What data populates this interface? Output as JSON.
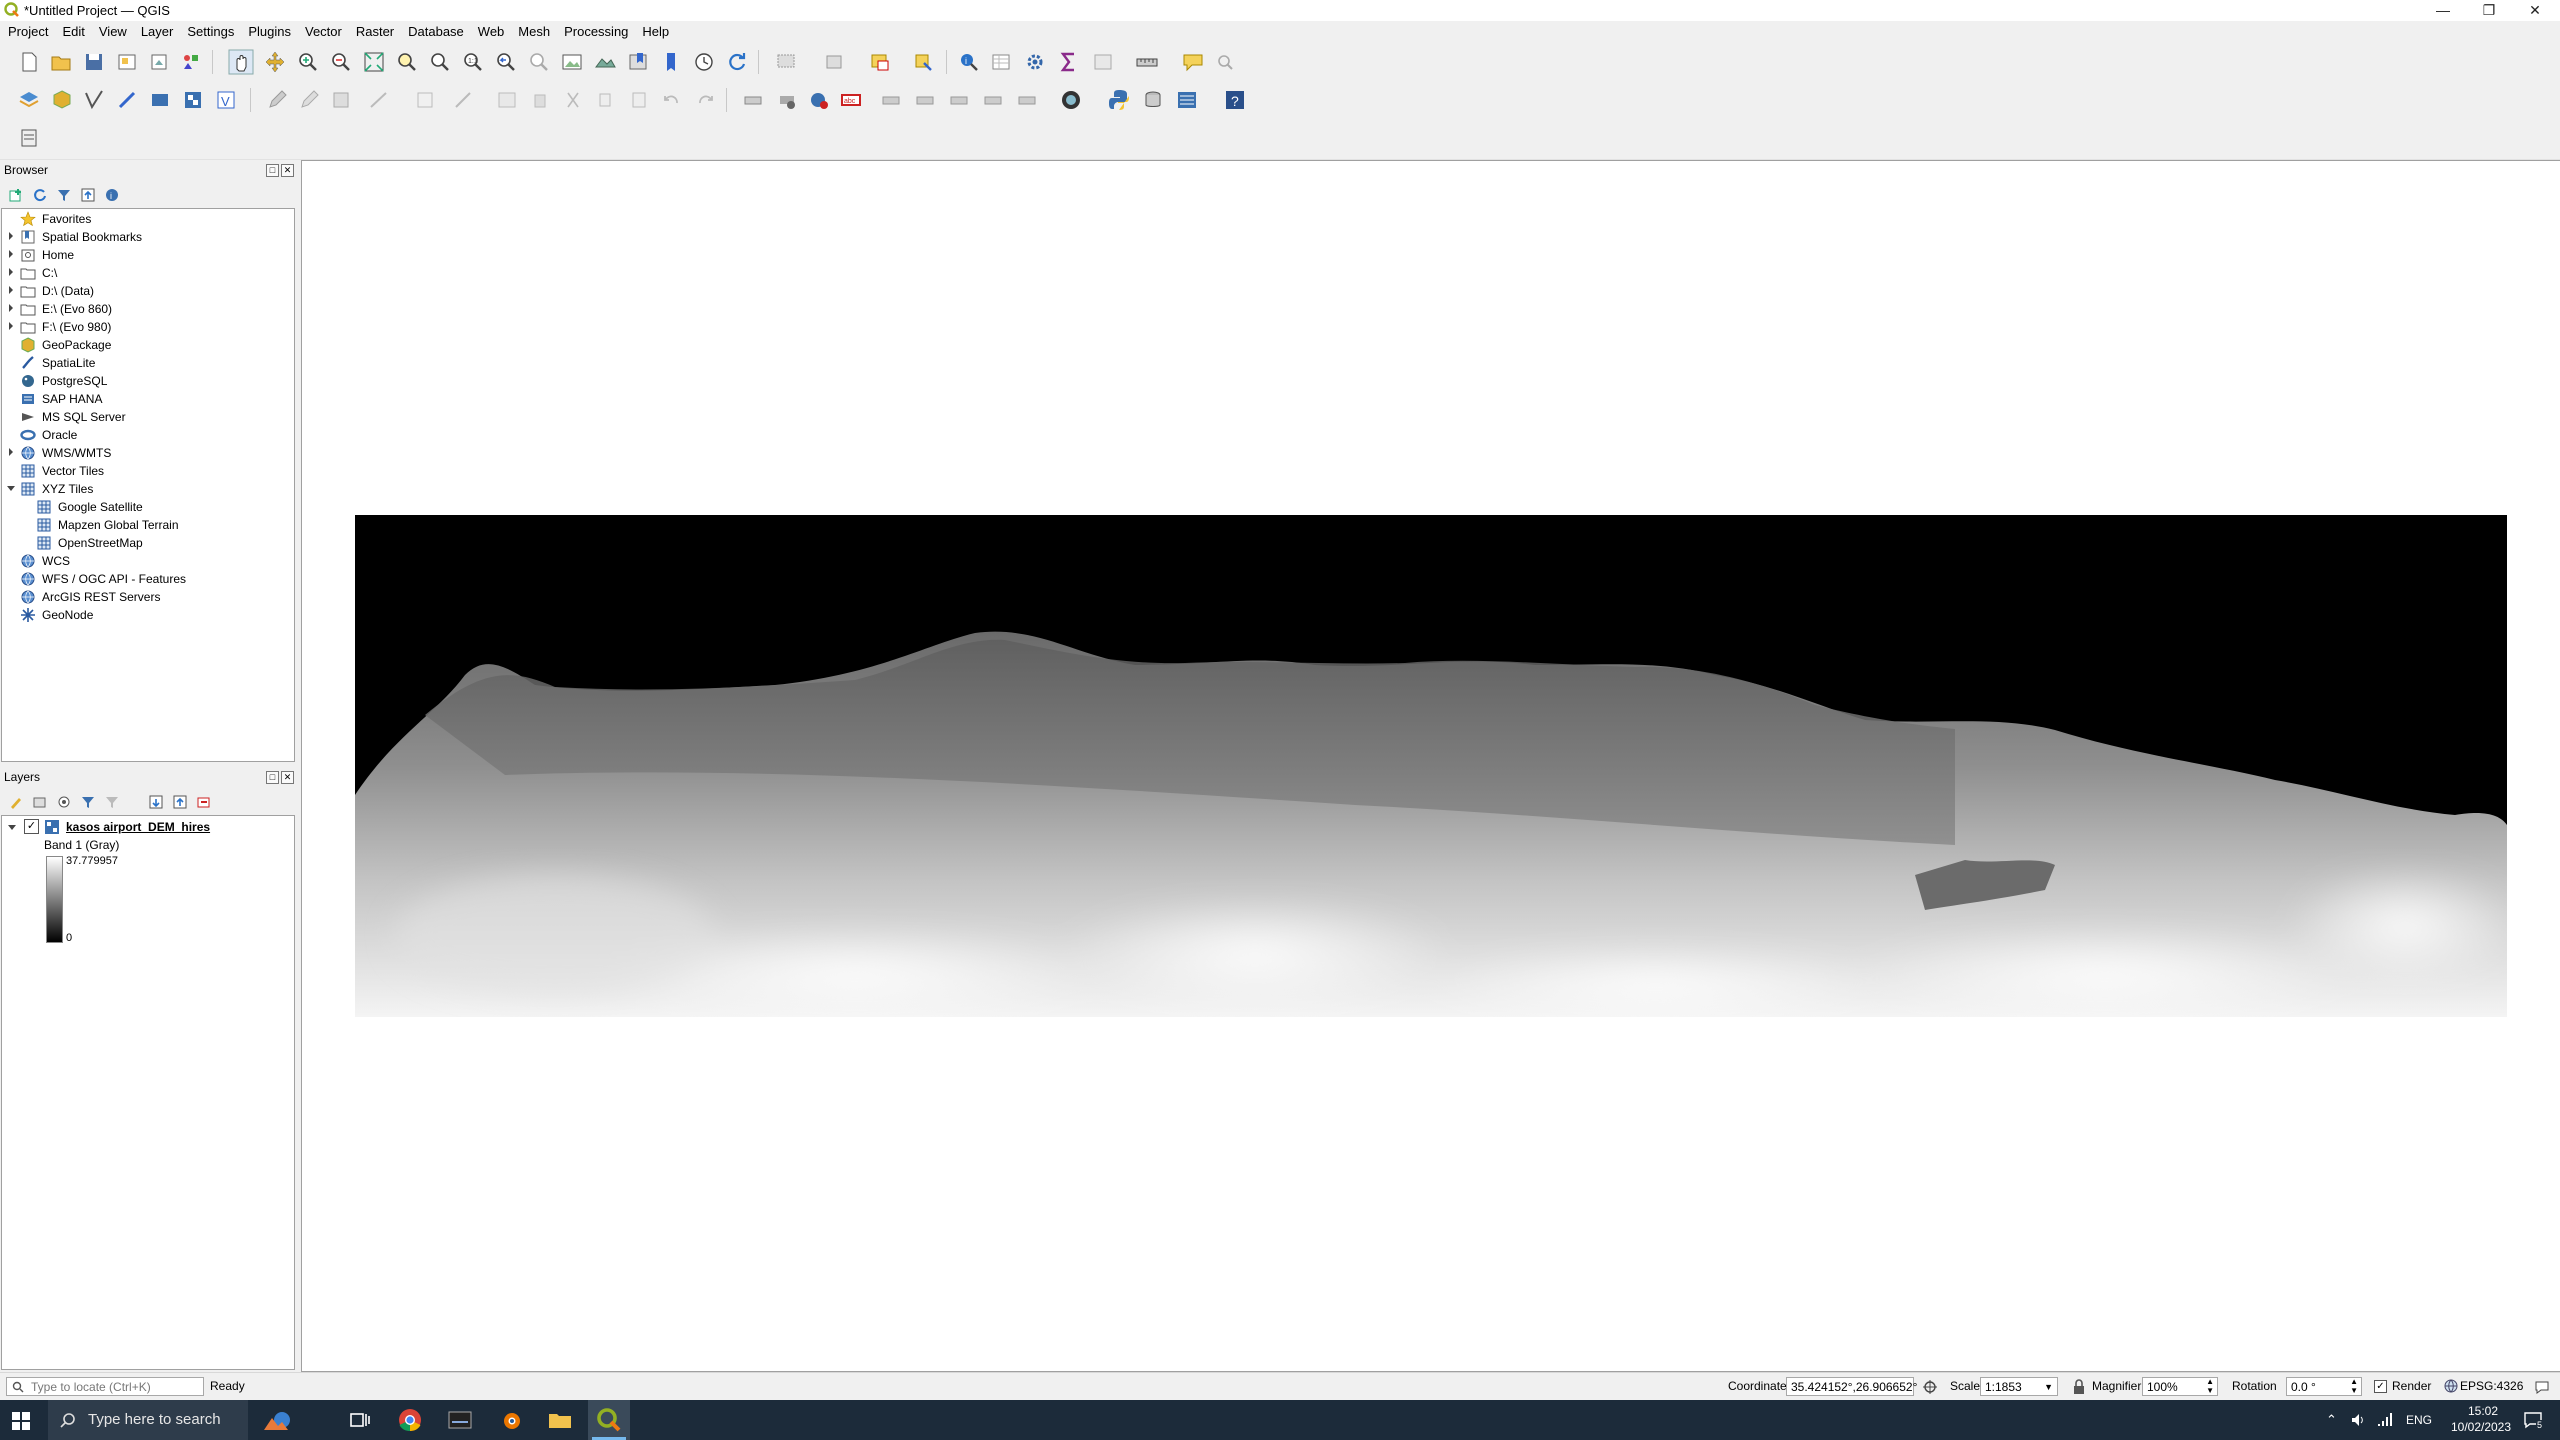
{
  "window": {
    "title": "*Untitled Project — QGIS"
  },
  "menu": [
    "Project",
    "Edit",
    "View",
    "Layer",
    "Settings",
    "Plugins",
    "Vector",
    "Raster",
    "Database",
    "Web",
    "Mesh",
    "Processing",
    "Help"
  ],
  "browser": {
    "title": "Browser",
    "items": [
      {
        "label": "Favorites",
        "icon": "star-icon",
        "expand": false
      },
      {
        "label": "Spatial Bookmarks",
        "icon": "bookmark-icon",
        "expand": true
      },
      {
        "label": "Home",
        "icon": "home-folder-icon",
        "expand": true
      },
      {
        "label": "C:\\",
        "icon": "folder-icon",
        "expand": true
      },
      {
        "label": "D:\\ (Data)",
        "icon": "folder-icon",
        "expand": true
      },
      {
        "label": "E:\\ (Evo 860)",
        "icon": "folder-icon",
        "expand": true
      },
      {
        "label": "F:\\ (Evo 980)",
        "icon": "folder-icon",
        "expand": true
      },
      {
        "label": "GeoPackage",
        "icon": "geopackage-icon",
        "expand": false
      },
      {
        "label": "SpatiaLite",
        "icon": "spatialite-icon",
        "expand": false
      },
      {
        "label": "PostgreSQL",
        "icon": "postgresql-icon",
        "expand": false
      },
      {
        "label": "SAP HANA",
        "icon": "sap-hana-icon",
        "expand": false
      },
      {
        "label": "MS SQL Server",
        "icon": "mssql-icon",
        "expand": false
      },
      {
        "label": "Oracle",
        "icon": "oracle-icon",
        "expand": false
      },
      {
        "label": "WMS/WMTS",
        "icon": "globe-icon",
        "expand": true
      },
      {
        "label": "Vector Tiles",
        "icon": "grid-icon",
        "expand": false
      },
      {
        "label": "XYZ Tiles",
        "icon": "grid-icon",
        "expand": "open"
      },
      {
        "label": "Google Satellite",
        "icon": "grid-icon",
        "expand": false,
        "child": true
      },
      {
        "label": "Mapzen Global Terrain",
        "icon": "grid-icon",
        "expand": false,
        "child": true
      },
      {
        "label": "OpenStreetMap",
        "icon": "grid-icon",
        "expand": false,
        "child": true
      },
      {
        "label": "WCS",
        "icon": "globe-icon",
        "expand": false
      },
      {
        "label": "WFS / OGC API - Features",
        "icon": "globe-icon",
        "expand": false
      },
      {
        "label": "ArcGIS REST Servers",
        "icon": "globe-icon",
        "expand": false
      },
      {
        "label": "GeoNode",
        "icon": "geonode-icon",
        "expand": false
      }
    ]
  },
  "layers": {
    "title": "Layers",
    "layer_name": "kasos airport_DEM_hires",
    "band_label": "Band 1 (Gray)",
    "max_value": "37.779957",
    "min_value": "0"
  },
  "status": {
    "locator_placeholder": "Type to locate (Ctrl+K)",
    "ready": "Ready",
    "coordinate_label": "Coordinate",
    "coordinate_value": "35.424152°,26.906652°",
    "scale_label": "Scale",
    "scale_value": "1:1853",
    "magnifier_label": "Magnifier",
    "magnifier_value": "100%",
    "rotation_label": "Rotation",
    "rotation_value": "0.0 °",
    "render_label": "Render",
    "crs": "EPSG:4326"
  },
  "taskbar": {
    "search_placeholder": "Type here to search",
    "lang": "ENG",
    "time": "15:02",
    "date": "10/02/2023",
    "notification_count": "5"
  },
  "colors": {
    "taskbar": "#1c2b3a",
    "accent_green": "#6abf40",
    "qgis_green": "#93b023"
  }
}
